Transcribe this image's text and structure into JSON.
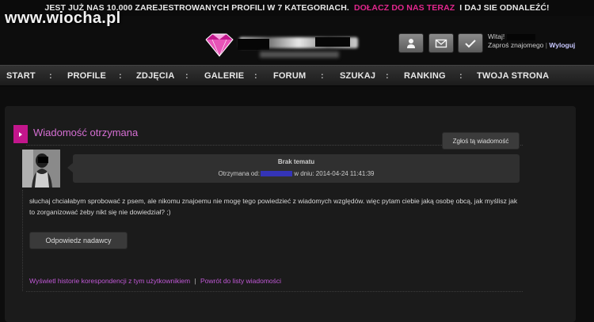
{
  "top_banner": {
    "text_part1": "JEST JUŻ NAS 10.000 ZAREJESTROWANYCH PROFILI  W 7 KATEGORIACH.",
    "join_link": "DOŁACZ DO NAS TERAZ",
    "text_part2": "I DAJ SIE ODNALEŹĆ!"
  },
  "watermark": "www.wiocha.pl",
  "header": {
    "icons": [
      "user-icon",
      "mail-icon",
      "checkmark-icon"
    ],
    "welcome_label": "Witaj!",
    "invite_link": "Zaproś znajomego",
    "separator": "|",
    "logout_link": "Wyloguj"
  },
  "nav": {
    "separator": ":",
    "items": [
      "START",
      "PROFILE",
      "ZDJĘCIA",
      "GALERIE",
      "FORUM",
      "SZUKAJ",
      "RANKING",
      "TWOJA STRONA"
    ]
  },
  "message_page": {
    "title": "Wiadomość otrzymana",
    "report_button": "Zgłoś tą wiadomość",
    "subject": "Brak tematu",
    "received_from_label": "Otrzymana od:",
    "received_date_label": "w dniu: 2014-04-24 11:41:39",
    "body": "słuchaj chciałabym sprobować z psem, ale nikomu znajoemu nie mogę tego powiedzieć z wiadomych względów. więc pytam ciebie jaką osobę obcą, jak myślisz jak to zorganizować żeby nikt się nie dowiedział? ;)",
    "reply_button": "Odpowiedz nadawcy",
    "history_link": "Wyświetl historie korespondencji z tym użytkownikiem",
    "link_separator": "|",
    "back_link": "Powrót do listy wiadomości"
  },
  "colors": {
    "accent_pink": "#e2278d",
    "title_purple": "#d56fd3",
    "link_purple": "#c058d6",
    "background": "#0d0d0d",
    "panel": "#1b1b1b"
  }
}
